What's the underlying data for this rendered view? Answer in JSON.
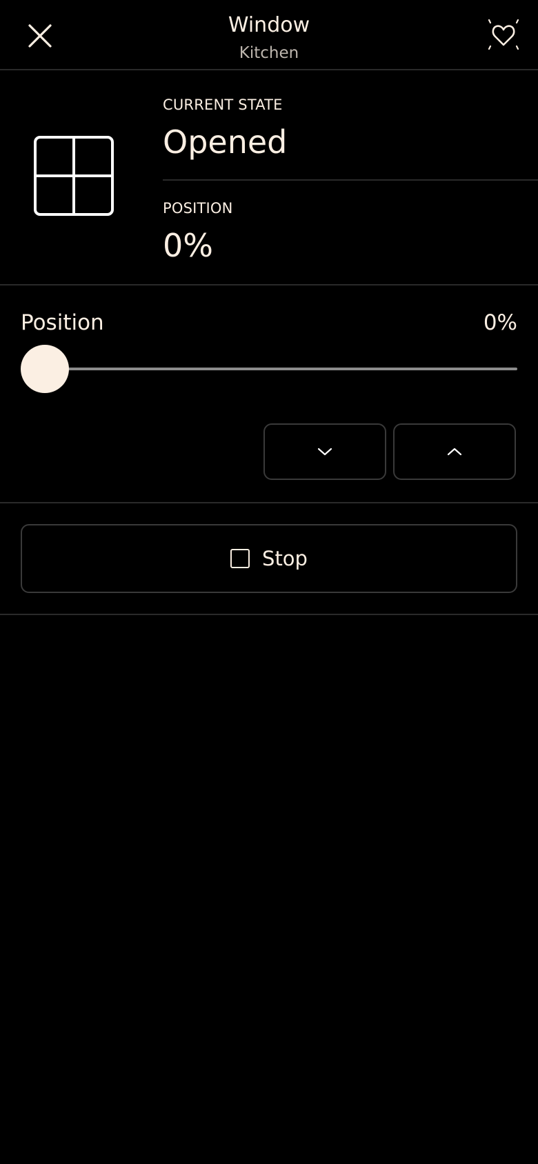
{
  "header": {
    "title": "Window",
    "subtitle": "Kitchen",
    "close_icon": "close-icon",
    "favorite_icon": "heart-sparkle-icon"
  },
  "state": {
    "device_icon": "window-icon",
    "current_state_label": "CURRENT STATE",
    "current_state_value": "Opened",
    "position_label": "POSITION",
    "position_value": "0%"
  },
  "slider": {
    "label": "Position",
    "value_text": "0%",
    "value_percent": 0
  },
  "controls": {
    "down_icon": "chevron-down-icon",
    "up_icon": "chevron-up-icon"
  },
  "stop": {
    "label": "Stop",
    "icon": "stop-square-icon"
  },
  "colors": {
    "background": "#000000",
    "foreground": "#FBEFE3",
    "muted": "#BDB6AE",
    "divider": "#2A2A2A",
    "track": "#8C8C8C"
  }
}
